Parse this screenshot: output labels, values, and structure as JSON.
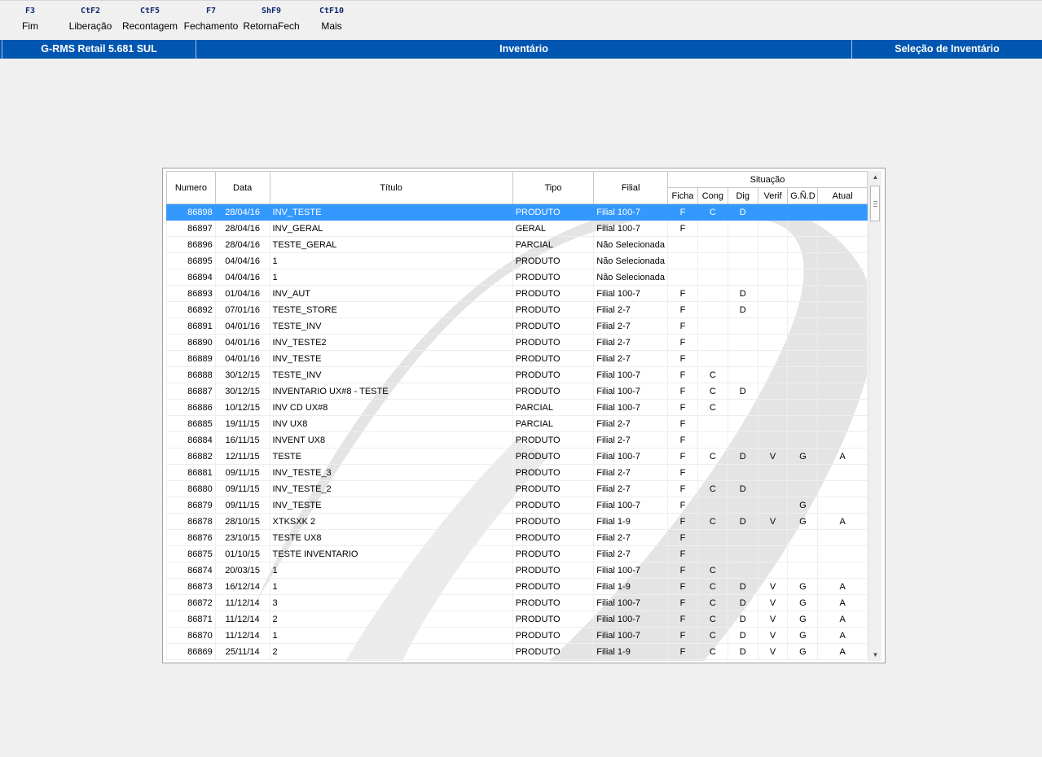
{
  "toolbar": [
    {
      "key": "F3",
      "label": "Fim"
    },
    {
      "key": "CtF2",
      "label": "Liberação"
    },
    {
      "key": "CtF5",
      "label": "Recontagem"
    },
    {
      "key": "F7",
      "label": "Fechamento"
    },
    {
      "key": "ShF9",
      "label": "RetornaFech"
    },
    {
      "key": "CtF10",
      "label": "Mais"
    }
  ],
  "titlebar": {
    "app": "G-RMS Retail 5.681 SUL",
    "module": "Inventário",
    "screen": "Seleção de Inventário"
  },
  "grid": {
    "headers": {
      "numero": "Numero",
      "data": "Data",
      "titulo": "Título",
      "tipo": "Tipo",
      "filial": "Filial",
      "situacao": "Situação",
      "ficha": "Ficha",
      "cong": "Cong",
      "dig": "Dig",
      "verif": "Verif",
      "gnd": "G.Ñ.D",
      "atual": "Atual"
    },
    "selected_index": 0,
    "rows": [
      [
        "86898",
        "28/04/16",
        "INV_TESTE",
        "PRODUTO",
        "Filial 100-7",
        "F",
        "C",
        "D",
        "",
        "",
        ""
      ],
      [
        "86897",
        "28/04/16",
        "INV_GERAL",
        "GERAL",
        "Filial 100-7",
        "F",
        "",
        "",
        "",
        "",
        ""
      ],
      [
        "86896",
        "28/04/16",
        "TESTE_GERAL",
        "PARCIAL",
        "Não Selecionada",
        "",
        "",
        "",
        "",
        "",
        ""
      ],
      [
        "86895",
        "04/04/16",
        "1",
        "PRODUTO",
        "Não Selecionada",
        "",
        "",
        "",
        "",
        "",
        ""
      ],
      [
        "86894",
        "04/04/16",
        "1",
        "PRODUTO",
        "Não Selecionada",
        "",
        "",
        "",
        "",
        "",
        ""
      ],
      [
        "86893",
        "01/04/16",
        "INV_AUT",
        "PRODUTO",
        "Filial 100-7",
        "F",
        "",
        "D",
        "",
        "",
        ""
      ],
      [
        "86892",
        "07/01/16",
        "TESTE_STORE",
        "PRODUTO",
        "Filial 2-7",
        "F",
        "",
        "D",
        "",
        "",
        ""
      ],
      [
        "86891",
        "04/01/16",
        "TESTE_INV",
        "PRODUTO",
        "Filial 2-7",
        "F",
        "",
        "",
        "",
        "",
        ""
      ],
      [
        "86890",
        "04/01/16",
        "INV_TESTE2",
        "PRODUTO",
        "Filial 2-7",
        "F",
        "",
        "",
        "",
        "",
        ""
      ],
      [
        "86889",
        "04/01/16",
        "INV_TESTE",
        "PRODUTO",
        "Filial 2-7",
        "F",
        "",
        "",
        "",
        "",
        ""
      ],
      [
        "86888",
        "30/12/15",
        "TESTE_INV",
        "PRODUTO",
        "Filial 100-7",
        "F",
        "C",
        "",
        "",
        "",
        ""
      ],
      [
        "86887",
        "30/12/15",
        "INVENTARIO UX#8 - TESTE",
        "PRODUTO",
        "Filial 100-7",
        "F",
        "C",
        "D",
        "",
        "",
        ""
      ],
      [
        "86886",
        "10/12/15",
        "INV CD UX#8",
        "PARCIAL",
        "Filial 100-7",
        "F",
        "C",
        "",
        "",
        "",
        ""
      ],
      [
        "86885",
        "19/11/15",
        "INV UX8",
        "PARCIAL",
        "Filial 2-7",
        "F",
        "",
        "",
        "",
        "",
        ""
      ],
      [
        "86884",
        "16/11/15",
        "INVENT UX8",
        "PRODUTO",
        "Filial 2-7",
        "F",
        "",
        "",
        "",
        "",
        ""
      ],
      [
        "86882",
        "12/11/15",
        "TESTE",
        "PRODUTO",
        "Filial 100-7",
        "F",
        "C",
        "D",
        "V",
        "G",
        "A"
      ],
      [
        "86881",
        "09/11/15",
        "INV_TESTE_3",
        "PRODUTO",
        "Filial 2-7",
        "F",
        "",
        "",
        "",
        "",
        ""
      ],
      [
        "86880",
        "09/11/15",
        "INV_TESTE_2",
        "PRODUTO",
        "Filial 2-7",
        "F",
        "C",
        "D",
        "",
        "",
        ""
      ],
      [
        "86879",
        "09/11/15",
        "INV_TESTE",
        "PRODUTO",
        "Filial 100-7",
        "F",
        "",
        "",
        "",
        "G",
        ""
      ],
      [
        "86878",
        "28/10/15",
        "XTKSXK 2",
        "PRODUTO",
        "Filial 1-9",
        "F",
        "C",
        "D",
        "V",
        "G",
        "A"
      ],
      [
        "86876",
        "23/10/15",
        "TESTE UX8",
        "PRODUTO",
        "Filial 2-7",
        "F",
        "",
        "",
        "",
        "",
        ""
      ],
      [
        "86875",
        "01/10/15",
        "TESTE INVENTARIO",
        "PRODUTO",
        "Filial 2-7",
        "F",
        "",
        "",
        "",
        "",
        ""
      ],
      [
        "86874",
        "20/03/15",
        "1",
        "PRODUTO",
        "Filial 100-7",
        "F",
        "C",
        "",
        "",
        "",
        ""
      ],
      [
        "86873",
        "16/12/14",
        "1",
        "PRODUTO",
        "Filial 1-9",
        "F",
        "C",
        "D",
        "V",
        "G",
        "A"
      ],
      [
        "86872",
        "11/12/14",
        "3",
        "PRODUTO",
        "Filial 100-7",
        "F",
        "C",
        "D",
        "V",
        "G",
        "A"
      ],
      [
        "86871",
        "11/12/14",
        "2",
        "PRODUTO",
        "Filial 100-7",
        "F",
        "C",
        "D",
        "V",
        "G",
        "A"
      ],
      [
        "86870",
        "11/12/14",
        "1",
        "PRODUTO",
        "Filial 100-7",
        "F",
        "C",
        "D",
        "V",
        "G",
        "A"
      ],
      [
        "86869",
        "25/11/14",
        "2",
        "PRODUTO",
        "Filial 1-9",
        "F",
        "C",
        "D",
        "V",
        "G",
        "A"
      ]
    ]
  }
}
